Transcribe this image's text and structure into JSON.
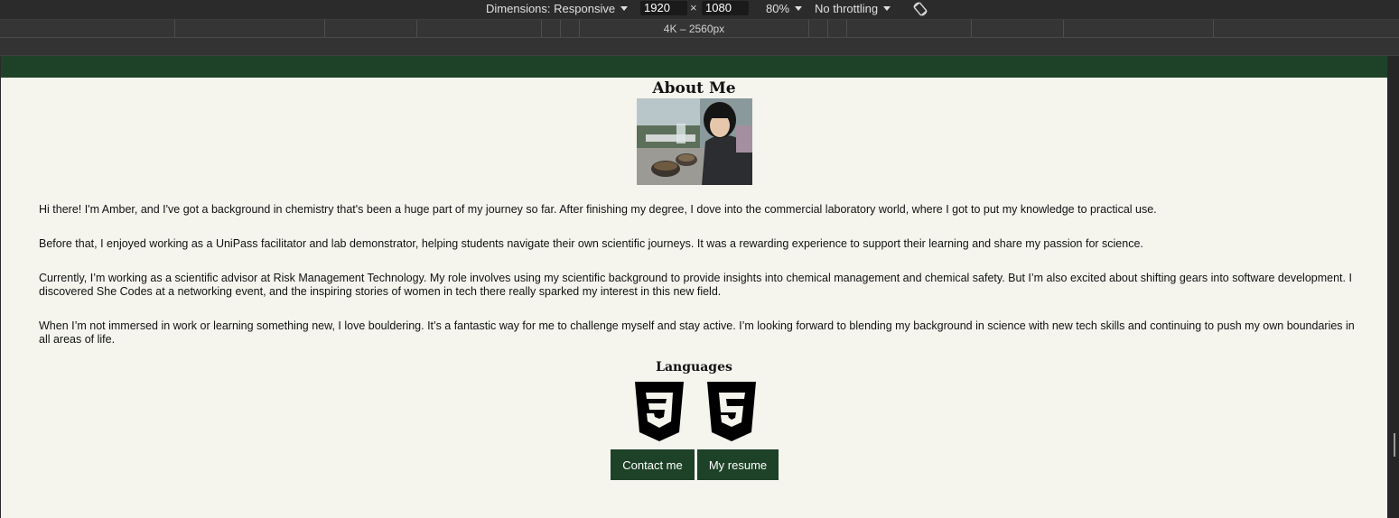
{
  "devtools": {
    "dimensions_label": "Dimensions: Responsive",
    "width": "1920",
    "height": "1080",
    "times": "×",
    "zoom": "80%",
    "throttling": "No throttling",
    "breakpoint_label": "4K – 2560px"
  },
  "page": {
    "header_color": "#1e4228",
    "background": "#f5f5ee",
    "about_title": "About Me",
    "paragraphs": [
      "Hi there! I'm Amber, and I've got a background in chemistry that's been a huge part of my journey so far. After finishing my degree, I dove into the commercial laboratory world, where I got to put my knowledge to practical use.",
      "Before that, I enjoyed working as a UniPass facilitator and lab demonstrator, helping students navigate their own scientific journeys. It was a rewarding experience to support their learning and share my passion for science.",
      "Currently, I’m working as a scientific advisor at Risk Management Technology. My role involves using my scientific background to provide insights into chemical management and chemical safety. But I’m also excited about shifting gears into software development. I discovered She Codes at a networking event, and the inspiring stories of women in tech there really sparked my interest in this new field.",
      "When I’m not immersed in work or learning something new, I love bouldering. It’s a fantastic way for me to challenge myself and stay active. I’m looking forward to blending my background in science with new tech skills and continuing to push my own boundaries in all areas of life."
    ],
    "languages_title": "Languages",
    "language_icons": [
      "css3-icon",
      "html5-icon"
    ],
    "buttons": {
      "contact": "Contact me",
      "resume": "My resume"
    }
  }
}
